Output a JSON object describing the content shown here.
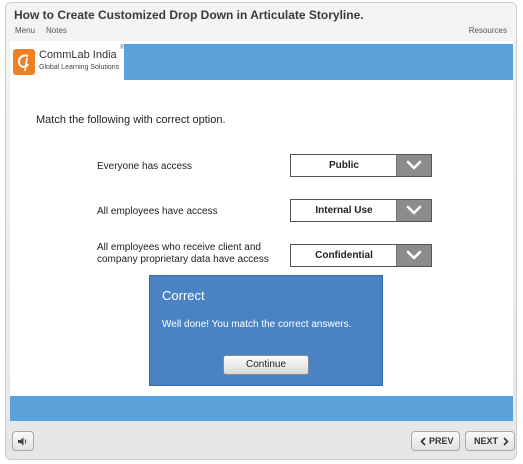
{
  "player": {
    "title": "How to Create Customized Drop Down in Articulate Storyline.",
    "tabs": {
      "menu": "Menu",
      "notes": "Notes",
      "resources": "Resources"
    }
  },
  "logo": {
    "name": "CommLab India",
    "registered": "®",
    "tagline": "Global Learning Solutions"
  },
  "slide": {
    "instruction": "Match the following with correct option.",
    "rows": [
      {
        "label": "Everyone has access",
        "selected": "Public"
      },
      {
        "label": "All employees have access",
        "selected": "Internal Use"
      },
      {
        "label": "All employees who receive client and company proprietary data have access",
        "selected": "Confidential"
      }
    ]
  },
  "feedback": {
    "title": "Correct",
    "message": "Well done! You match the correct answers.",
    "continue_label": "Continue"
  },
  "controls": {
    "prev_label": "PREV",
    "next_label": "NEXT"
  },
  "colors": {
    "accent_blue": "#5aa2d9",
    "feedback_blue": "#4a83c4",
    "logo_orange": "#f07e23"
  },
  "icons": {
    "logo": "commlab-logo-icon",
    "volume": "volume-icon",
    "dropdown": "chevron-down-icon"
  }
}
